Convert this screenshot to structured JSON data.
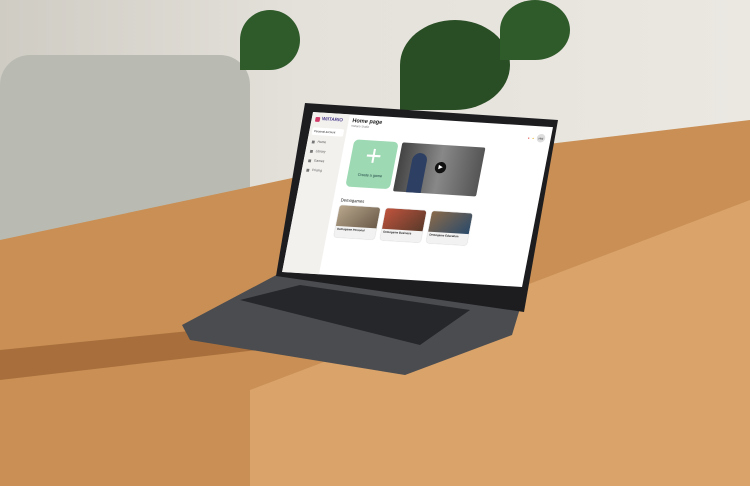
{
  "app": {
    "brand": "WIITARIO",
    "account": "Personal account"
  },
  "sidebar": {
    "items": [
      {
        "label": "Home"
      },
      {
        "label": "Library"
      },
      {
        "label": "Games"
      },
      {
        "label": "Pricing"
      }
    ]
  },
  "header": {
    "title": "Home page",
    "subtitle": "Wiitario Studio",
    "avatar_initials": "HW"
  },
  "main": {
    "create_label": "Create a game",
    "section_title": "Demogames",
    "demos": [
      {
        "title": "Demogame Personal"
      },
      {
        "title": "Demogame Business"
      },
      {
        "title": "Demogame Education"
      }
    ]
  },
  "colors": {
    "accent": "#9dd9b3",
    "brand": "#4a3b8c"
  }
}
